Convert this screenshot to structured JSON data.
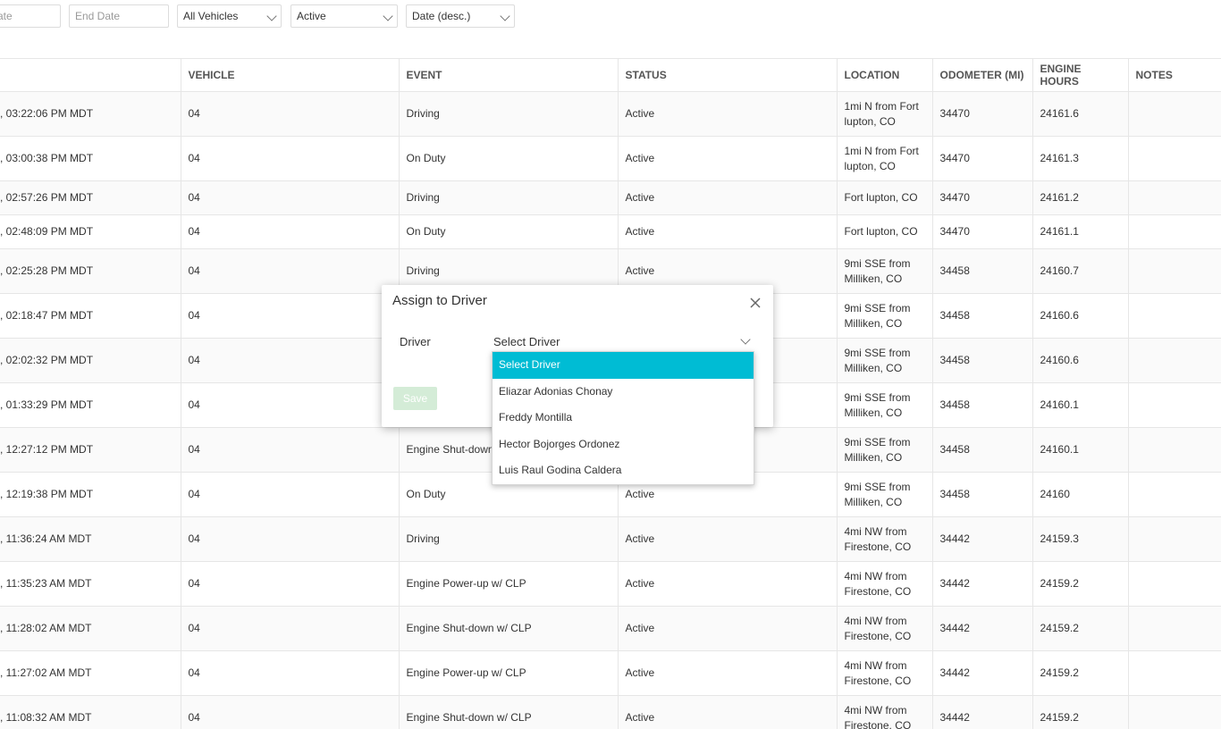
{
  "filters": {
    "start_date_placeholder": "ate",
    "end_date_placeholder": "End Date",
    "vehicle_select": "All Vehicles",
    "status_select": "Active",
    "sort_select": "Date (desc.)"
  },
  "table": {
    "headers": [
      "",
      "VEHICLE",
      "EVENT",
      "STATUS",
      "LOCATION",
      "ODOMETER (MI)",
      "ENGINE HOURS",
      "NOTES"
    ],
    "rows": [
      {
        "time": ", 03:22:06 PM MDT",
        "vehicle": "04",
        "event": "Driving",
        "status": "Active",
        "location": "1mi N from Fort lupton, CO",
        "odometer": "34470",
        "hours": "24161.6",
        "notes": ""
      },
      {
        "time": ", 03:00:38 PM MDT",
        "vehicle": "04",
        "event": "On Duty",
        "status": "Active",
        "location": "1mi N from Fort lupton, CO",
        "odometer": "34470",
        "hours": "24161.3",
        "notes": ""
      },
      {
        "time": ", 02:57:26 PM MDT",
        "vehicle": "04",
        "event": "Driving",
        "status": "Active",
        "location": "Fort lupton, CO",
        "odometer": "34470",
        "hours": "24161.2",
        "notes": ""
      },
      {
        "time": ", 02:48:09 PM MDT",
        "vehicle": "04",
        "event": "On Duty",
        "status": "Active",
        "location": "Fort lupton, CO",
        "odometer": "34470",
        "hours": "24161.1",
        "notes": ""
      },
      {
        "time": ", 02:25:28 PM MDT",
        "vehicle": "04",
        "event": "Driving",
        "status": "Active",
        "location": "9mi SSE from Milliken, CO",
        "odometer": "34458",
        "hours": "24160.7",
        "notes": ""
      },
      {
        "time": ", 02:18:47 PM MDT",
        "vehicle": "04",
        "event": "",
        "status": "",
        "location": "9mi SSE from Milliken, CO",
        "odometer": "34458",
        "hours": "24160.6",
        "notes": ""
      },
      {
        "time": ", 02:02:32 PM MDT",
        "vehicle": "04",
        "event": "",
        "status": "",
        "location": "9mi SSE from Milliken, CO",
        "odometer": "34458",
        "hours": "24160.6",
        "notes": ""
      },
      {
        "time": ", 01:33:29 PM MDT",
        "vehicle": "04",
        "event": "",
        "status": "",
        "location": "9mi SSE from Milliken, CO",
        "odometer": "34458",
        "hours": "24160.1",
        "notes": ""
      },
      {
        "time": ", 12:27:12 PM MDT",
        "vehicle": "04",
        "event": "Engine Shut-down",
        "status": "",
        "location": "9mi SSE from Milliken, CO",
        "odometer": "34458",
        "hours": "24160.1",
        "notes": ""
      },
      {
        "time": ", 12:19:38 PM MDT",
        "vehicle": "04",
        "event": "On Duty",
        "status": "Active",
        "location": "9mi SSE from Milliken, CO",
        "odometer": "34458",
        "hours": "24160",
        "notes": ""
      },
      {
        "time": ", 11:36:24 AM MDT",
        "vehicle": "04",
        "event": "Driving",
        "status": "Active",
        "location": "4mi NW from Firestone, CO",
        "odometer": "34442",
        "hours": "24159.3",
        "notes": ""
      },
      {
        "time": ", 11:35:23 AM MDT",
        "vehicle": "04",
        "event": "Engine Power-up w/ CLP",
        "status": "Active",
        "location": "4mi NW from Firestone, CO",
        "odometer": "34442",
        "hours": "24159.2",
        "notes": ""
      },
      {
        "time": ", 11:28:02 AM MDT",
        "vehicle": "04",
        "event": "Engine Shut-down w/ CLP",
        "status": "Active",
        "location": "4mi NW from Firestone, CO",
        "odometer": "34442",
        "hours": "24159.2",
        "notes": ""
      },
      {
        "time": ", 11:27:02 AM MDT",
        "vehicle": "04",
        "event": "Engine Power-up w/ CLP",
        "status": "Active",
        "location": "4mi NW from Firestone, CO",
        "odometer": "34442",
        "hours": "24159.2",
        "notes": ""
      },
      {
        "time": ", 11:08:32 AM MDT",
        "vehicle": "04",
        "event": "Engine Shut-down w/ CLP",
        "status": "Active",
        "location": "4mi NW from Firestone, CO",
        "odometer": "34442",
        "hours": "24159.2",
        "notes": ""
      }
    ]
  },
  "dialog": {
    "title": "Assign to Driver",
    "driver_label": "Driver",
    "select_value": "Select Driver",
    "save_label": "Save",
    "options": [
      "Select Driver",
      "Eliazar Adonias Chonay",
      "Freddy Montilla",
      "Hector Bojorges Ordonez",
      "Luis Raul Godina Caldera"
    ],
    "selected_index": 0
  },
  "colors": {
    "selected_option_bg": "#00bcd4",
    "save_button_bg": "#d4ecd7",
    "row_stripe": "#fafafa"
  }
}
